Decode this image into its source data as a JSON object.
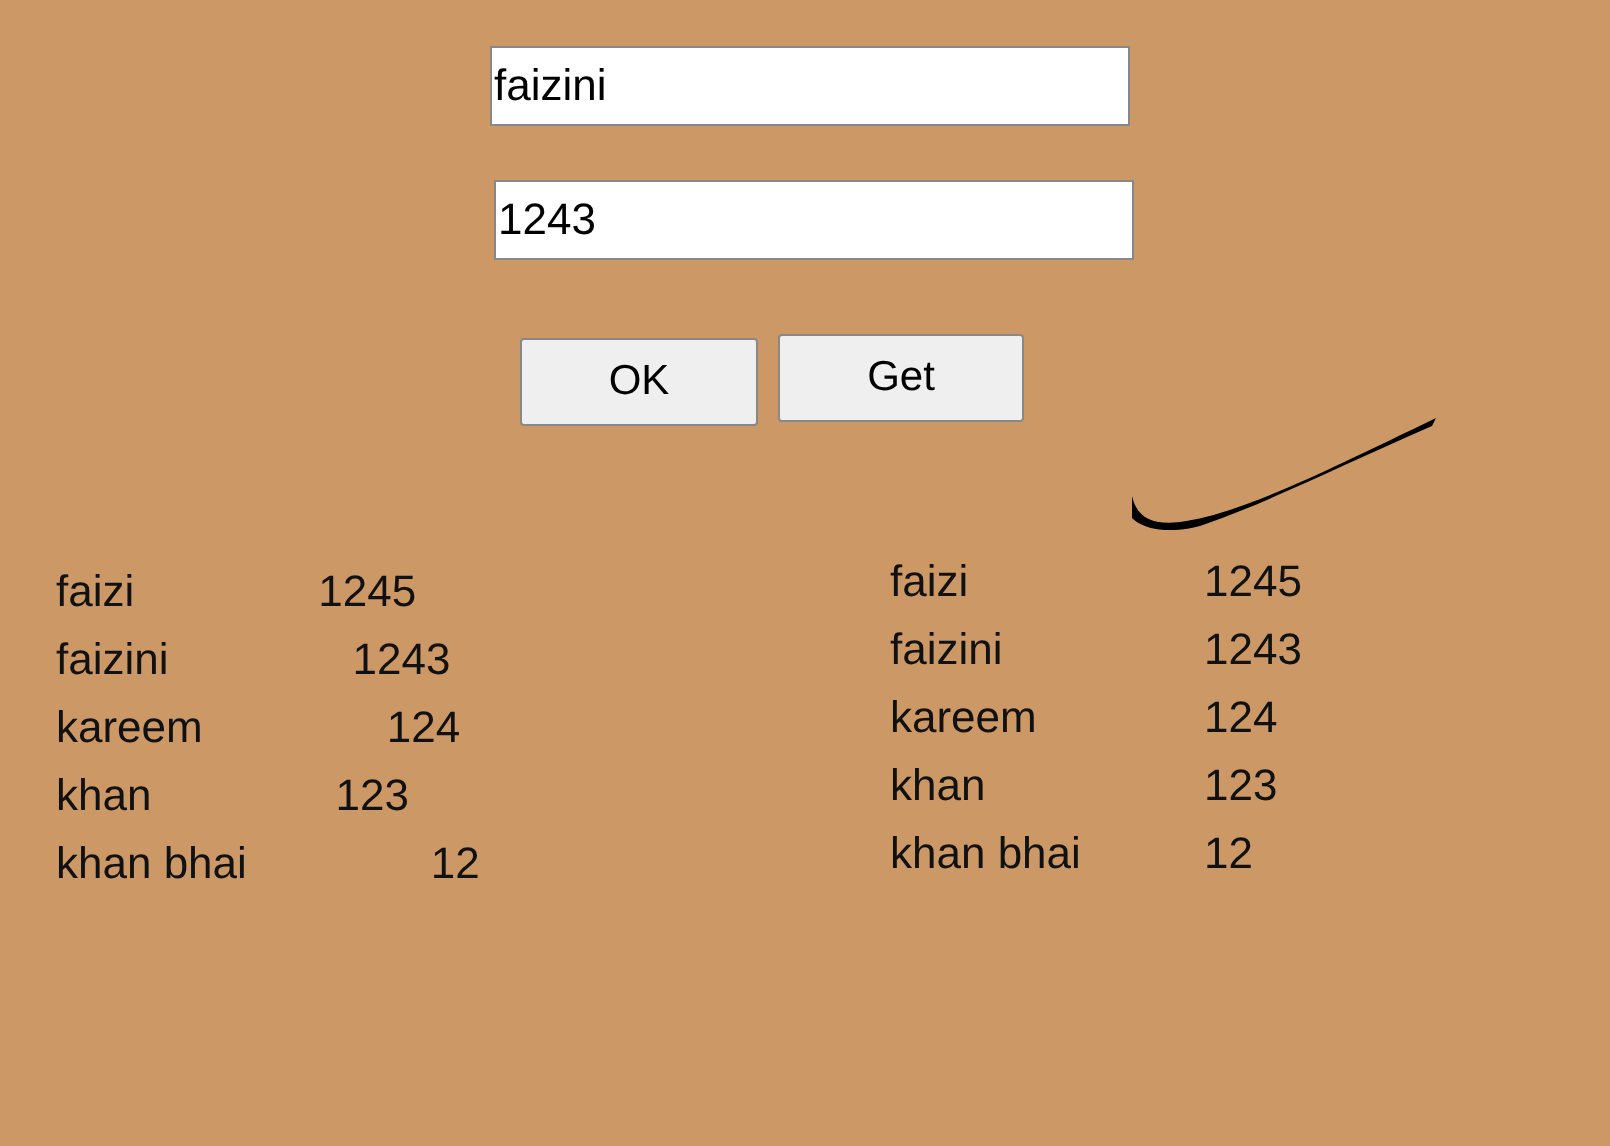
{
  "form": {
    "name_field": {
      "value": "faizini"
    },
    "number_field": {
      "value": "1243"
    },
    "buttons": [
      "OK",
      "Get"
    ]
  },
  "list_left": [
    {
      "name": "faizi",
      "number": "1245"
    },
    {
      "name": "faizini",
      "number": "1243"
    },
    {
      "name": "kareem",
      "number": "124"
    },
    {
      "name": "khan",
      "number": "123"
    },
    {
      "name": "khan bhai",
      "number": "12"
    }
  ],
  "list_right": [
    {
      "name": "faizi",
      "number": "1245"
    },
    {
      "name": "faizini",
      "number": "1243"
    },
    {
      "name": "kareem",
      "number": "124"
    },
    {
      "name": "khan",
      "number": "123"
    },
    {
      "name": "khan bhai",
      "number": "12"
    }
  ]
}
